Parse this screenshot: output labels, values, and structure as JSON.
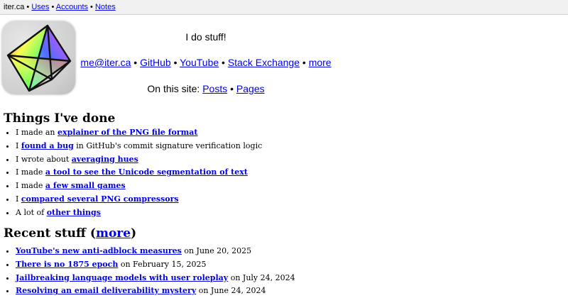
{
  "topbar": {
    "site": "iter.ca",
    "sep": " • ",
    "links": [
      "Uses",
      "Accounts",
      "Notes"
    ]
  },
  "hero": {
    "tagline": "I do stuff!",
    "contact_links": [
      "me@iter.ca",
      "GitHub",
      "YouTube",
      "Stack Exchange",
      "more"
    ],
    "sep": " • ",
    "site_prefix": "On this site: ",
    "site_links": [
      "Posts",
      "Pages"
    ]
  },
  "things": {
    "heading": "Things I've done",
    "items": [
      {
        "pre": "I made an ",
        "link": "explainer of the PNG file format",
        "post": ""
      },
      {
        "pre": "I ",
        "link": "found a bug",
        "post": " in GitHub's commit signature verification logic"
      },
      {
        "pre": "I wrote about ",
        "link": "averaging hues",
        "post": ""
      },
      {
        "pre": "I made ",
        "link": "a tool to see the Unicode segmentation of text",
        "post": ""
      },
      {
        "pre": "I made ",
        "link": "a few small games",
        "post": ""
      },
      {
        "pre": "I ",
        "link": "compared several PNG compressors",
        "post": ""
      },
      {
        "pre": "A lot of ",
        "link": "other things",
        "post": ""
      }
    ]
  },
  "recent": {
    "heading_pre": "Recent stuff (",
    "heading_link": "more",
    "heading_post": ")",
    "items": [
      {
        "link": "YouTube's new anti-adblock measures",
        "post": " on June 20, 2025"
      },
      {
        "link": "There is no 1875 epoch",
        "post": " on February 15, 2025"
      },
      {
        "link": "Jailbreaking language models with user roleplay",
        "post": " on July 24, 2024"
      },
      {
        "link": "Resolving an email deliverability mystery",
        "post": " on June 24, 2024"
      }
    ]
  },
  "colors": {
    "link": "#0000ee",
    "topbar_bg": "#f1f1f1"
  },
  "icons": {
    "logo": "octahedron-logo-icon"
  }
}
